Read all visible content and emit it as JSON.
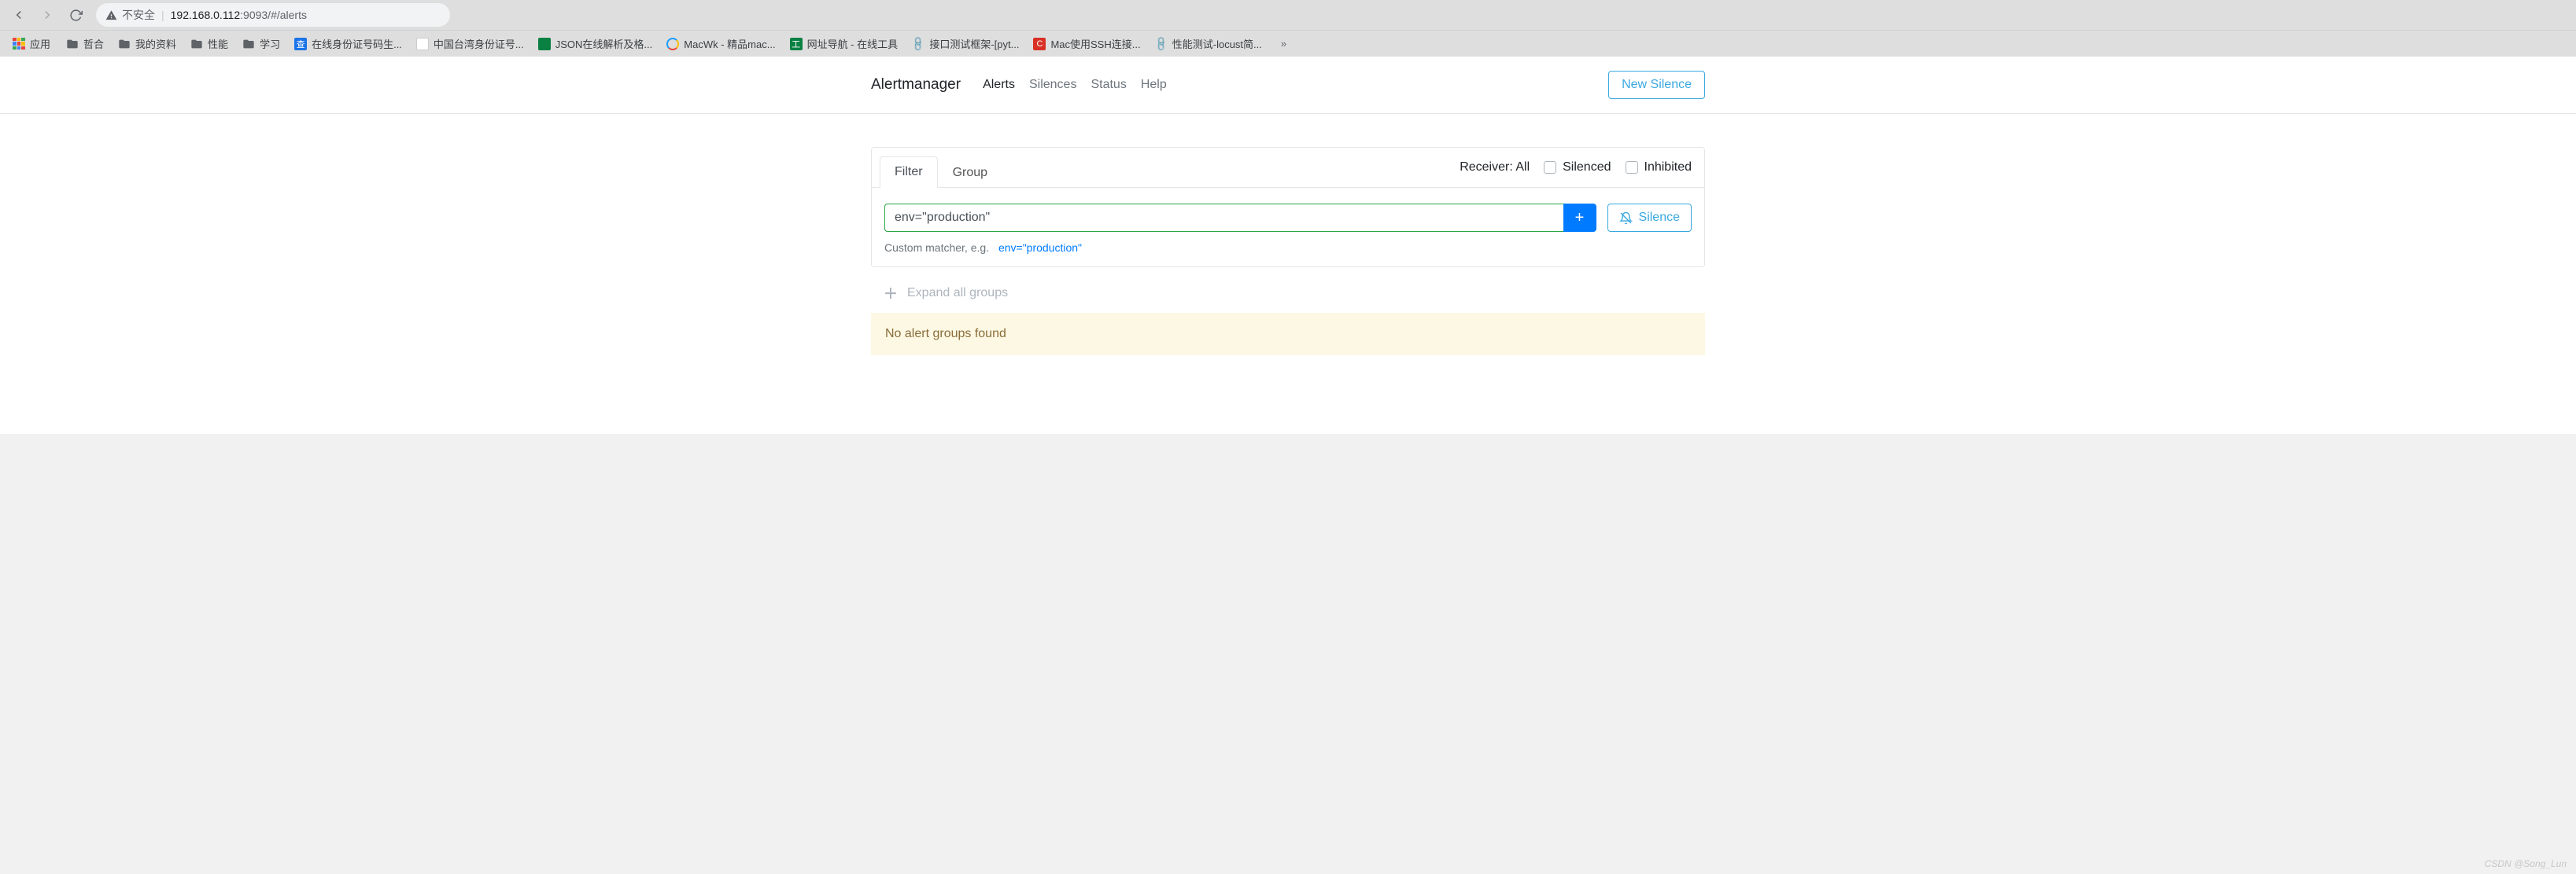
{
  "browser": {
    "insecure_label": "不安全",
    "url_host": "192.168.0.112",
    "url_port_path": ":9093/#/alerts",
    "apps_label": "应用",
    "bookmarks": [
      {
        "label": "哲合",
        "kind": "folder"
      },
      {
        "label": "我的资料",
        "kind": "folder"
      },
      {
        "label": "性能",
        "kind": "folder"
      },
      {
        "label": "学习",
        "kind": "folder"
      },
      {
        "label": "在线身份证号码生...",
        "kind": "fav-blue",
        "glyph": "查"
      },
      {
        "label": "中国台湾身份证号...",
        "kind": "fav-img"
      },
      {
        "label": "JSON在线解析及格...",
        "kind": "fav-green"
      },
      {
        "label": "MacWk - 精品mac...",
        "kind": "fav-c"
      },
      {
        "label": "网址导航 - 在线工具",
        "kind": "fav-greenbox",
        "glyph": "工"
      },
      {
        "label": "接口测试框架-[pyt...",
        "kind": "link"
      },
      {
        "label": "Mac使用SSH连接...",
        "kind": "fav-red",
        "glyph": "C"
      },
      {
        "label": "性能测试-locust简...",
        "kind": "link"
      }
    ]
  },
  "app": {
    "brand": "Alertmanager",
    "nav": {
      "alerts": "Alerts",
      "silences": "Silences",
      "status": "Status",
      "help": "Help"
    },
    "new_silence": "New Silence"
  },
  "filters": {
    "tab_filter": "Filter",
    "tab_group": "Group",
    "receiver_label": "Receiver: All",
    "silenced_label": "Silenced",
    "inhibited_label": "Inhibited",
    "input_value": "env=\"production\"",
    "silence_btn": "Silence",
    "help_prefix": "Custom matcher, e.g.",
    "help_example": "env=\"production\""
  },
  "body": {
    "expand_label": "Expand all groups",
    "empty_message": "No alert groups found"
  },
  "watermark": "CSDN @Song_Lun"
}
